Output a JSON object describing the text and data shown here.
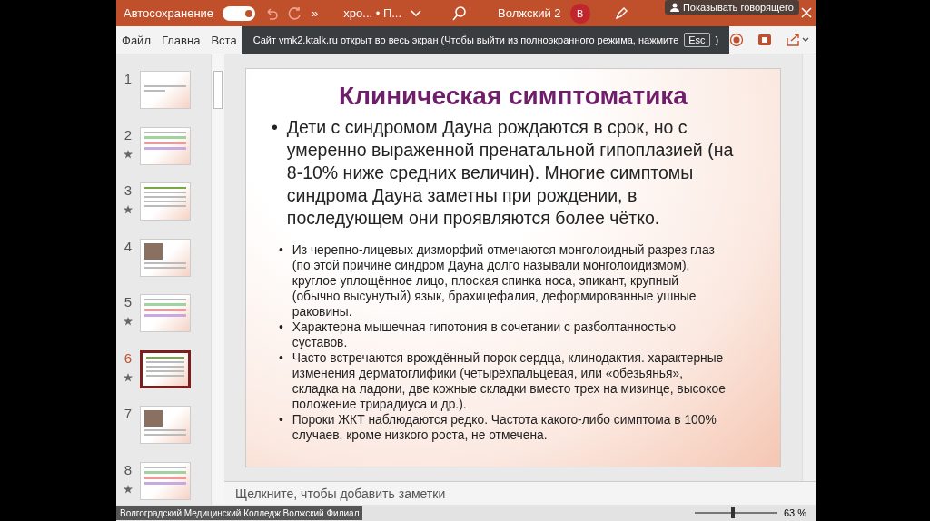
{
  "title_bar": {
    "autosave_label": "Автосохранение",
    "autosave_on": true,
    "overflow": "»",
    "document": "хро... • П...",
    "user": "Волжский 2",
    "avatar": "В",
    "speaker_button": "Показывать говорящего"
  },
  "ribbon": {
    "tabs": [
      {
        "label": "Файл",
        "selected": false
      },
      {
        "label": "Главна",
        "selected": false
      },
      {
        "label": "Вста",
        "selected": false
      }
    ]
  },
  "fullscreen_notice": {
    "text": "Сайт vmk2.ktalk.ru открыт во весь экран (Чтобы выйти из полноэкранного режима, нажмите",
    "key": "Esc",
    "close_paren": ")"
  },
  "slides": [
    {
      "number": "1",
      "kind": "title",
      "animated": false,
      "selected": false
    },
    {
      "number": "2",
      "kind": "list",
      "animated": true,
      "selected": false
    },
    {
      "number": "3",
      "kind": "text",
      "animated": true,
      "selected": false
    },
    {
      "number": "4",
      "kind": "photo",
      "animated": false,
      "selected": false
    },
    {
      "number": "5",
      "kind": "list",
      "animated": true,
      "selected": false
    },
    {
      "number": "6",
      "kind": "text",
      "animated": true,
      "selected": true
    },
    {
      "number": "7",
      "kind": "photo",
      "animated": false,
      "selected": false
    },
    {
      "number": "8",
      "kind": "list",
      "animated": true,
      "selected": false
    }
  ],
  "slide": {
    "title": "Клиническая симптоматика",
    "main_bullets": [
      {
        "marker": "•",
        "text": "Дети с синдромом Дауна рождаются в срок, но с умеренно выраженной пренатальной гипоплазией (на 8-10% ниже средних величин). Многие симптомы синдрома Дауна заметны при рождении, в последующем они проявляются более чётко."
      }
    ],
    "sub_bullets": [
      {
        "marker": "•",
        "text": "Из черепно-лицевых дизморфий отмечаются монголоидный разрез глаз (по этой причине синдром Дауна долго называли монголоидизмом), круглое уплощённое лицо, плоская спинка носа, эпикант, крупный (обычно высунутый) язык, брахицефалия, деформированные ушные раковины."
      },
      {
        "marker": "•",
        "text": "Характерна мышечная гипотония в сочетании с разболтанностью суставов."
      },
      {
        "marker": "•",
        "text": "Часто встречаются врождённый порок сердца, клинодактия. характерные изменения дерматоглифики (четырёхпальцевая, или «обезьянья», складка на ладони, две кожные складки вместо трех на мизинце, высокое положение трирадиуса и др.)."
      },
      {
        "marker": "•",
        "text": "Пороки ЖКТ наблюдаются редко. Частота какого-либо симптома в 100% случаев, кроме низкого роста, не отмечена."
      }
    ]
  },
  "notes": {
    "placeholder": "Щелкните, чтобы добавить заметки"
  },
  "status_bar": {
    "participant_label": "Волгоградский Медицинский Колледж Волжский Филиал",
    "zoom": "63 %",
    "zoom_slider": {
      "level": 0.45
    }
  }
}
